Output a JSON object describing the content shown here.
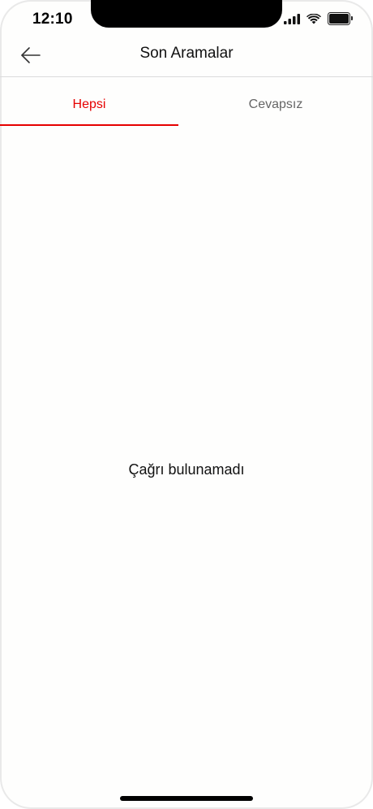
{
  "status_bar": {
    "time": "12:10",
    "icons": [
      "signal-icon",
      "wifi-icon",
      "battery-icon"
    ]
  },
  "header": {
    "back_icon": "arrow-left-icon",
    "title": "Son Aramalar"
  },
  "tabs": [
    {
      "label": "Hepsi",
      "active": true
    },
    {
      "label": "Cevapsız",
      "active": false
    }
  ],
  "empty_state": {
    "message": "Çağrı bulunamadı"
  },
  "colors": {
    "accent": "#e60000",
    "inactive_tab": "#666666",
    "background": "#fefefd"
  }
}
